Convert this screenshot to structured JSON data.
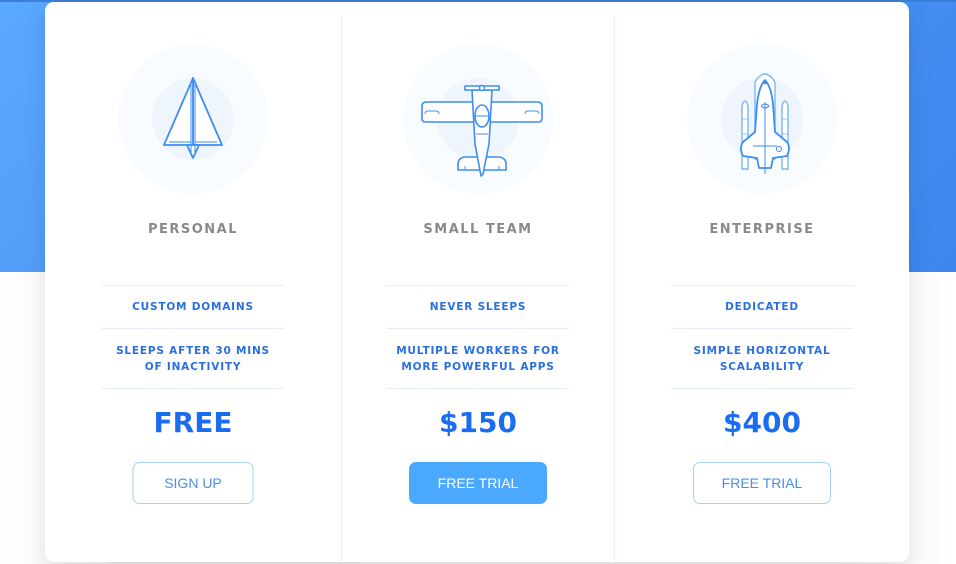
{
  "colors": {
    "brand_blue": "#4aa8ff",
    "price_blue": "#1a6cf0",
    "feature_blue": "#2a6fe0",
    "plan_name_gray": "#8a8a8a",
    "hero_gradient_start": "#5aa8ff",
    "hero_gradient_end": "#3d86ee"
  },
  "plans": [
    {
      "icon": "paper-plane-icon",
      "name": "PERSONAL",
      "features": [
        "CUSTOM DOMAINS",
        "SLEEPS AFTER 30 MINS OF INACTIVITY"
      ],
      "price": "FREE",
      "button_label": "SIGN UP",
      "button_style": "outline"
    },
    {
      "icon": "airplane-icon",
      "name": "SMALL TEAM",
      "features": [
        "NEVER SLEEPS",
        "MULTIPLE WORKERS FOR MORE POWERFUL APPS"
      ],
      "price": "$150",
      "button_label": "FREE TRIAL",
      "button_style": "filled"
    },
    {
      "icon": "space-shuttle-icon",
      "name": "ENTERPRISE",
      "features": [
        "DEDICATED",
        "SIMPLE HORIZONTAL SCALABILITY"
      ],
      "price": "$400",
      "button_label": "FREE TRIAL",
      "button_style": "outline"
    }
  ]
}
